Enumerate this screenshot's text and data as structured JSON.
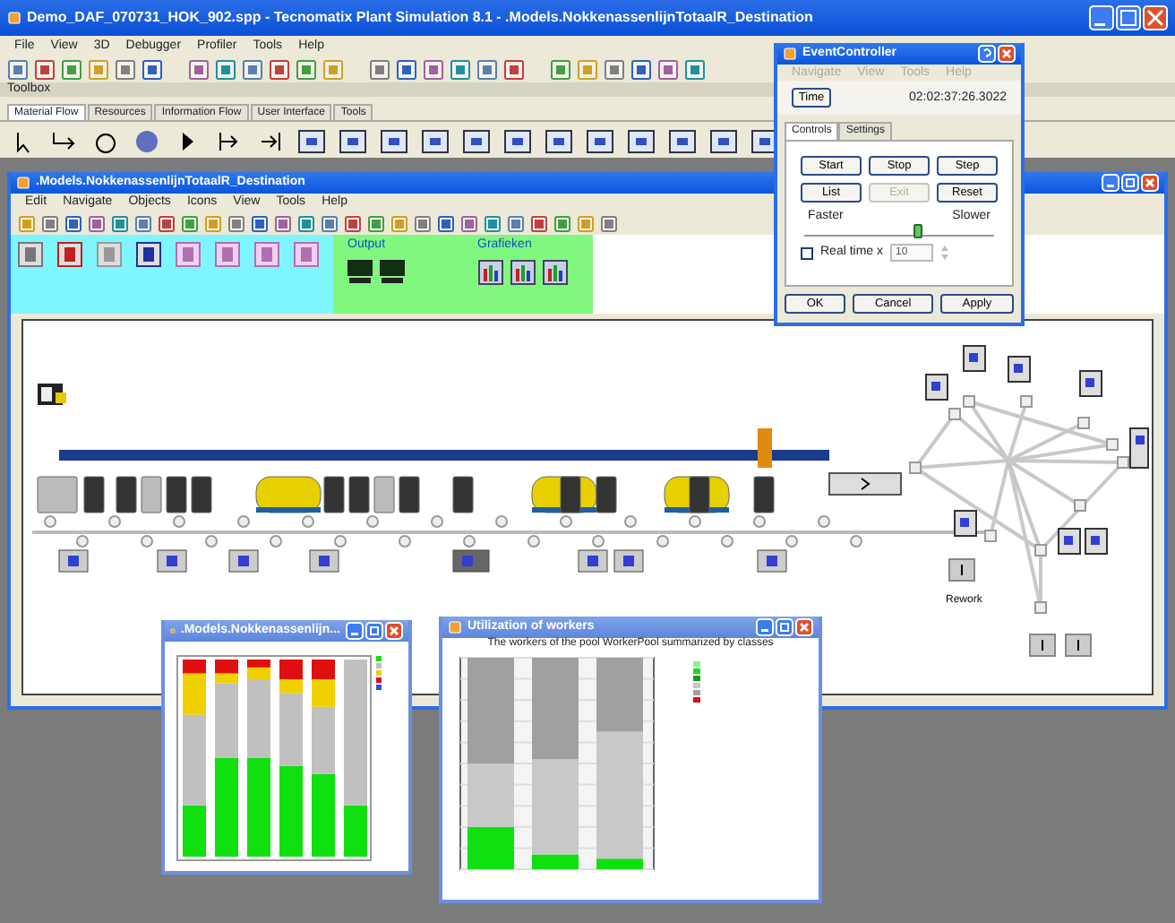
{
  "app": {
    "title": "Demo_DAF_070731_HOK_902.spp - Tecnomatix Plant Simulation 8.1 - .Models.NokkenassenlijnTotaalR_Destination",
    "menu": [
      "File",
      "View",
      "3D",
      "Debugger",
      "Profiler",
      "Tools",
      "Help"
    ]
  },
  "toolbox": {
    "title": "Toolbox",
    "tabs": [
      {
        "label": "Material Flow",
        "selected": true
      },
      {
        "label": "Resources",
        "selected": false
      },
      {
        "label": "Information Flow",
        "selected": false
      },
      {
        "label": "User Interface",
        "selected": false
      },
      {
        "label": "Tools",
        "selected": false
      }
    ]
  },
  "frame": {
    "title": ".Models.NokkenassenlijnTotaalR_Destination",
    "menu": [
      "Edit",
      "Navigate",
      "Objects",
      "Icons",
      "View",
      "Tools",
      "Help"
    ],
    "palette_groups": [
      {
        "label": "Output",
        "color": "#80f880"
      },
      {
        "label": "Grafieken",
        "color": "#80f880"
      }
    ],
    "canvas_labels": [
      "Rework"
    ]
  },
  "event_controller": {
    "title": "EventController",
    "menu": [
      "Navigate",
      "View",
      "Tools",
      "Help"
    ],
    "time_button": "Time",
    "time": "02:02:37:26.3022",
    "tabs": [
      {
        "label": "Controls",
        "selected": true
      },
      {
        "label": "Settings",
        "selected": false
      }
    ],
    "buttons": [
      {
        "label": "Start",
        "disabled": false
      },
      {
        "label": "Stop",
        "disabled": false
      },
      {
        "label": "Step",
        "disabled": false
      },
      {
        "label": "List",
        "disabled": false
      },
      {
        "label": "Exit",
        "disabled": true
      },
      {
        "label": "Reset",
        "disabled": false
      }
    ],
    "faster": "Faster",
    "slower": "Slower",
    "speed": {
      "level": 0.6
    },
    "real_time": {
      "label": "Real time x",
      "checked": false,
      "value": "10"
    },
    "footer_buttons": [
      "OK",
      "Cancel",
      "Apply"
    ]
  },
  "chart_windows": [
    {
      "title": ".Models.Nokkenassenlijn..."
    },
    {
      "title": "Utilization of workers",
      "chart_title": "The workers of the pool WorkerPool summarized by classes"
    }
  ]
}
